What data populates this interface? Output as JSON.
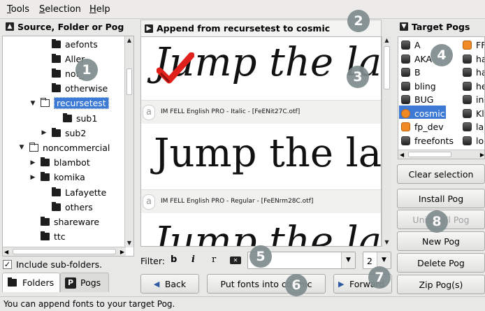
{
  "menu": [
    {
      "label": "Tools",
      "mnemonic": "T",
      "rest": "ools"
    },
    {
      "label": "Selection",
      "mnemonic": "S",
      "rest": "election"
    },
    {
      "label": "Help",
      "mnemonic": "H",
      "rest": "elp"
    }
  ],
  "left_panel": {
    "title": "Source, Folder or Pog",
    "tree": [
      {
        "label": "aefonts",
        "indent": 3,
        "expander": "",
        "icon": "closed"
      },
      {
        "label": "Aller",
        "indent": 3,
        "expander": "",
        "icon": "closed"
      },
      {
        "label": "not_",
        "indent": 3,
        "expander": "",
        "icon": "closed"
      },
      {
        "label": "otherwise",
        "indent": 3,
        "expander": "",
        "icon": "closed"
      },
      {
        "label": "recursetest",
        "indent": 2,
        "expander": "▼",
        "icon": "open",
        "selected": true
      },
      {
        "label": "sub1",
        "indent": 4,
        "expander": "",
        "icon": "closed"
      },
      {
        "label": "sub2",
        "indent": 3,
        "expander": "▶",
        "icon": "closed"
      },
      {
        "label": "noncommercial",
        "indent": 1,
        "expander": "▼",
        "icon": "open"
      },
      {
        "label": "blambot",
        "indent": 2,
        "expander": "▶",
        "icon": "closed"
      },
      {
        "label": "komika",
        "indent": 2,
        "expander": "▶",
        "icon": "closed"
      },
      {
        "label": "Lafayette",
        "indent": 3,
        "expander": "",
        "icon": "closed"
      },
      {
        "label": "others",
        "indent": 3,
        "expander": "",
        "icon": "closed"
      },
      {
        "label": "shareware",
        "indent": 2,
        "expander": "",
        "icon": "closed"
      },
      {
        "label": "ttc",
        "indent": 2,
        "expander": "",
        "icon": "closed"
      }
    ],
    "include_subfolders": {
      "label": "Include sub-folders.",
      "checked": "✓"
    },
    "tabs": [
      {
        "label": "Folders",
        "icon": "folder-icon",
        "active": true
      },
      {
        "label": "Pogs",
        "icon_letter": "P",
        "active": false
      }
    ]
  },
  "middle_panel": {
    "title": "Append from recursetest to cosmic",
    "samples": [
      {
        "text": "Jump the lazy",
        "info": "IM FELL English PRO - Italic - [FeENit27C.otf]",
        "italic": true
      },
      {
        "text": "Jump the lazy",
        "info": "IM FELL English PRO - Regular - [FeENrm28C.otf]",
        "italic": false
      },
      {
        "text": "Jump the lazy",
        "info": "",
        "italic": true
      }
    ],
    "filter": {
      "label": "Filter:",
      "buttons": [
        "b",
        "i",
        "r"
      ],
      "combo_value": "",
      "count_value": "2"
    },
    "buttons": {
      "back": "Back",
      "put_fonts": "Put fonts into cosmic",
      "forward": "Forward"
    }
  },
  "right_panel": {
    "title": "Target Pogs",
    "pogs_col1": [
      {
        "label": "A",
        "icon": "grey"
      },
      {
        "label": "AKA",
        "icon": "grey"
      },
      {
        "label": "B",
        "icon": "grey"
      },
      {
        "label": "bling",
        "icon": "grey"
      },
      {
        "label": "BUG",
        "icon": "grey"
      },
      {
        "label": "cosmic",
        "icon": "sel",
        "selected": true
      },
      {
        "label": "fp_dev",
        "icon": "orange"
      },
      {
        "label": "freefonts",
        "icon": "grey"
      }
    ],
    "pogs_col2": [
      {
        "label": "FF",
        "icon": "orange"
      },
      {
        "label": "ha",
        "icon": "grey"
      },
      {
        "label": "ha",
        "icon": "grey"
      },
      {
        "label": "he",
        "icon": "grey"
      },
      {
        "label": "in",
        "icon": "grey"
      },
      {
        "label": "Kl",
        "icon": "grey"
      },
      {
        "label": "la",
        "icon": "grey"
      },
      {
        "label": "lo",
        "icon": "grey"
      }
    ],
    "buttons": {
      "clear_selection": "Clear selection",
      "install_pog": "Install Pog",
      "uninstall_pog": "Uninstall Pog",
      "new_pog": "New Pog",
      "delete_pog": "Delete Pog",
      "zip_pogs": "Zip Pog(s)"
    }
  },
  "status": "You can append fonts to your target Pog.",
  "callouts": [
    "1",
    "2",
    "3",
    "4",
    "5",
    "6",
    "7",
    "8"
  ],
  "colors": {
    "selection": "#3c7ad5",
    "callout": "#7f8c8e",
    "checkmark": "#e0201a",
    "pog_orange": "#f08a24"
  }
}
